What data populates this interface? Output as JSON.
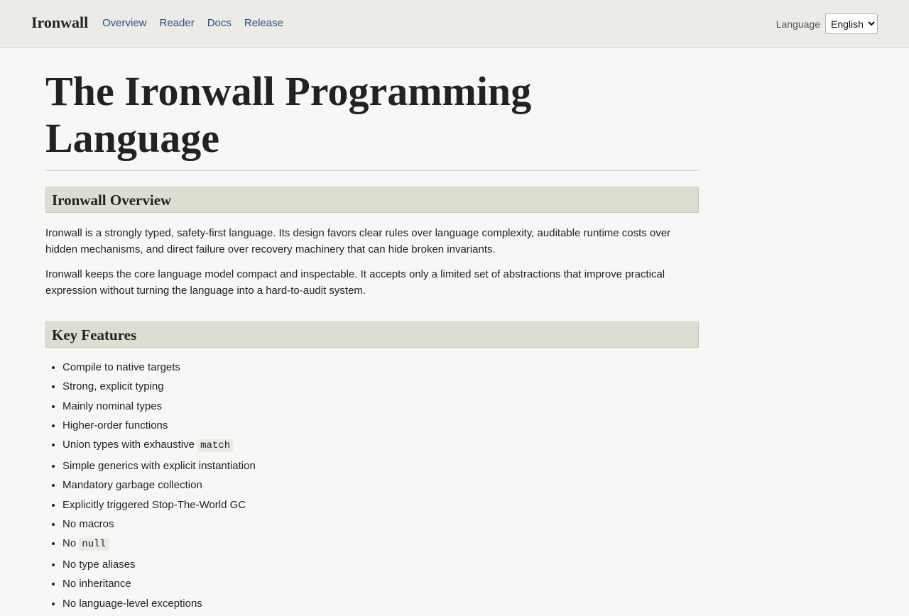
{
  "header": {
    "brand": "Ironwall",
    "nav": [
      {
        "label": "Overview"
      },
      {
        "label": "Reader"
      },
      {
        "label": "Docs"
      },
      {
        "label": "Release"
      }
    ],
    "language_label": "Language",
    "language_selected": "English"
  },
  "main": {
    "title": "The Ironwall Programming Language",
    "overview": {
      "heading": "Ironwall Overview",
      "paragraphs": [
        "Ironwall is a strongly typed, safety-first language. Its design favors clear rules over language complexity, auditable runtime costs over hidden mechanisms, and direct failure over recovery machinery that can hide broken invariants.",
        "Ironwall keeps the core language model compact and inspectable. It accepts only a limited set of abstractions that improve practical expression without turning the language into a hard-to-audit system."
      ]
    },
    "features": {
      "heading": "Key Features",
      "items": [
        {
          "text": "Compile to native targets"
        },
        {
          "text": "Strong, explicit typing"
        },
        {
          "text": "Mainly nominal types"
        },
        {
          "text": "Higher-order functions"
        },
        {
          "text": "Union types with exhaustive ",
          "code": "match"
        },
        {
          "text": "Simple generics with explicit instantiation"
        },
        {
          "text": "Mandatory garbage collection"
        },
        {
          "text": "Explicitly triggered Stop-The-World GC"
        },
        {
          "text": "No macros"
        },
        {
          "text": "No ",
          "code": "null"
        },
        {
          "text": "No type aliases"
        },
        {
          "text": "No inheritance"
        },
        {
          "text": "No language-level exceptions"
        }
      ]
    }
  }
}
